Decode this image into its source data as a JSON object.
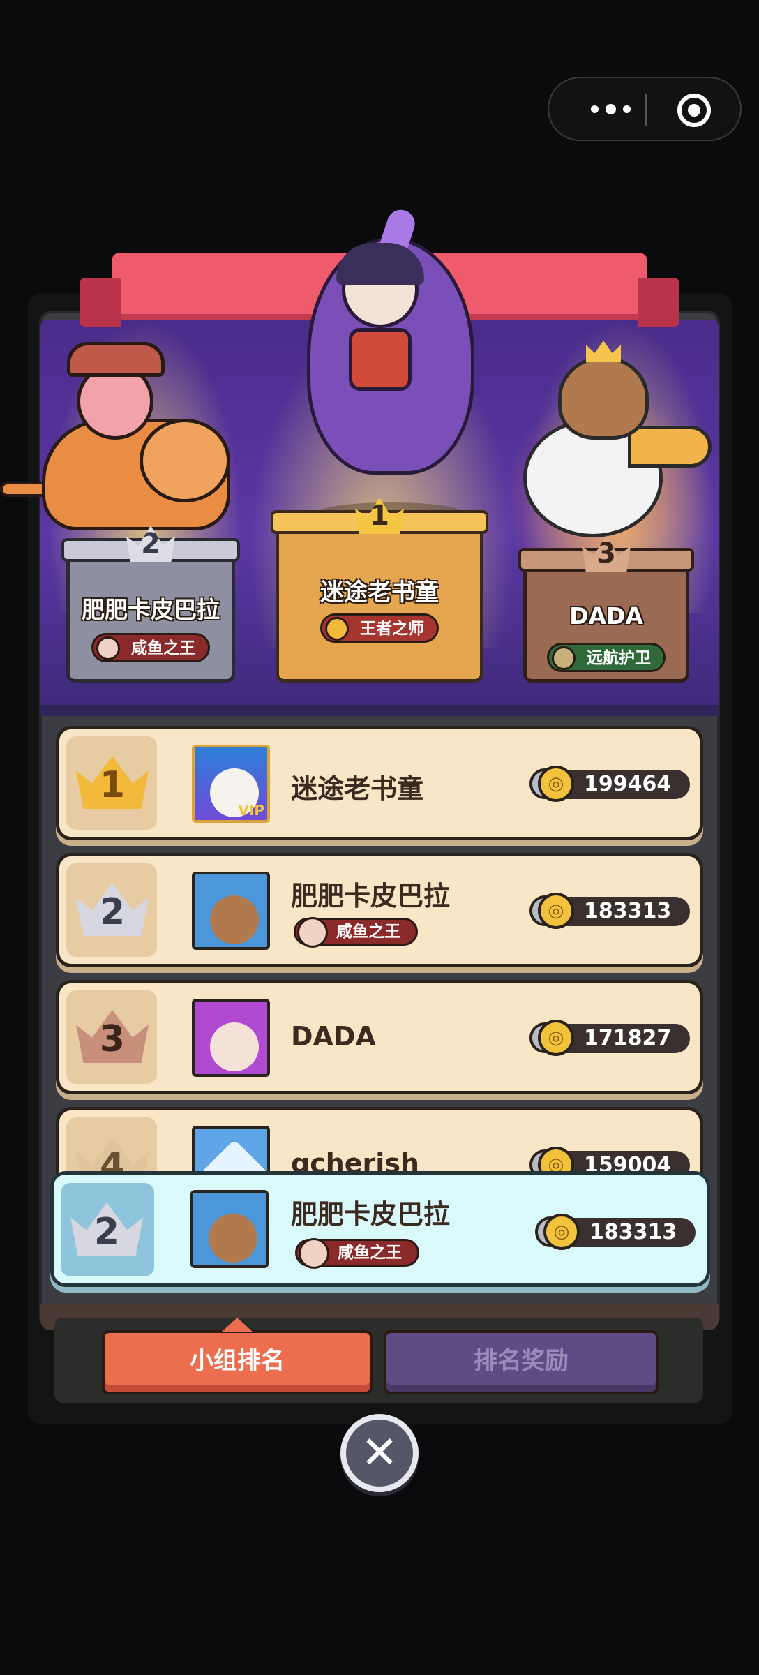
{
  "capsule": {
    "more_icon": "more-dots-icon",
    "target_icon": "target-icon"
  },
  "podium": {
    "first": {
      "rank": "1",
      "name": "迷途老书童",
      "title": "王者之师"
    },
    "second": {
      "rank": "2",
      "name": "肥肥卡皮巴拉",
      "title": "咸鱼之王"
    },
    "third": {
      "rank": "3",
      "name": "DADA",
      "title": "远航护卫"
    }
  },
  "ranking": [
    {
      "rank": "1",
      "name": "迷途老书童",
      "title": "",
      "score": "199464",
      "vip": "VIP",
      "crown": "gold"
    },
    {
      "rank": "2",
      "name": "肥肥卡皮巴拉",
      "title": "咸鱼之王",
      "score": "183313",
      "crown": "silver"
    },
    {
      "rank": "3",
      "name": "DADA",
      "title": "",
      "score": "171827",
      "crown": "bronze"
    },
    {
      "rank": "4",
      "name": "gcherish",
      "title": "",
      "score": "159004",
      "crown": "plain"
    }
  ],
  "self": {
    "rank": "2",
    "name": "肥肥卡皮巴拉",
    "title": "咸鱼之王",
    "score": "183313"
  },
  "tabs": {
    "group_rank": "小组排名",
    "rank_reward": "排名奖励",
    "active": "group_rank"
  },
  "close_icon": "close-icon",
  "colors": {
    "accent": "#ec6e4e",
    "self_highlight": "#d9f9fb",
    "row_bg": "#f8e6c6",
    "stage": "#5b38a5"
  }
}
